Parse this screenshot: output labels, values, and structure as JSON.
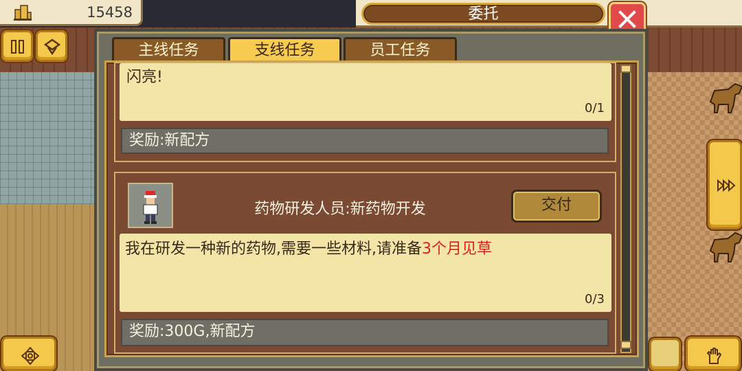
{
  "topbar": {
    "money": "15458",
    "money_icon": "building-icon"
  },
  "dialog": {
    "title": "委托",
    "close_icon": "close-icon",
    "tabs": [
      {
        "label": "主线任务",
        "active": false
      },
      {
        "label": "支线任务",
        "active": true
      },
      {
        "label": "员工任务",
        "active": false
      }
    ]
  },
  "quests": [
    {
      "text": "闪亮!",
      "progress": "0/1",
      "reward": "奖励:新配方"
    },
    {
      "npc": "药物研发人员:新药物开发",
      "deliver_label": "交付",
      "text_prefix": "我在研发一种新的药物,需要一些材料,请准备",
      "text_highlight": "3个月见草",
      "progress": "0/3",
      "reward": "奖励:300G,新配方"
    }
  ],
  "colors": {
    "accent": "#f6cb4f",
    "highlight": "#e02020",
    "close": "#e04a4a"
  },
  "side_buttons": [
    "pause-icon",
    "view-toggle-icon",
    "fast-forward-icon",
    "move-icon",
    "hand-icon"
  ]
}
